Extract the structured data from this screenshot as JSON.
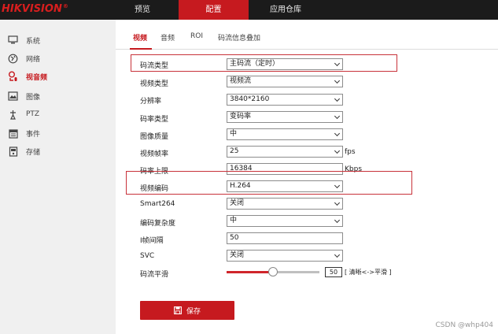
{
  "brand": {
    "logo_text": "HIKVISION",
    "reg_mark": "®"
  },
  "top_nav": [
    "预览",
    "配置",
    "应用仓库"
  ],
  "sidebar": {
    "items": [
      {
        "label": "系统",
        "icon": "monitor-icon"
      },
      {
        "label": "网络",
        "icon": "globe-icon"
      },
      {
        "label": "视音频",
        "icon": "camera-mic-icon",
        "active": true
      },
      {
        "label": "图像",
        "icon": "image-icon"
      },
      {
        "label": "PTZ",
        "icon": "ptz-icon"
      },
      {
        "label": "事件",
        "icon": "calendar-icon"
      },
      {
        "label": "存储",
        "icon": "storage-icon"
      }
    ]
  },
  "subtabs": [
    "视频",
    "音频",
    "ROI",
    "码流信息叠加"
  ],
  "form": {
    "stream_type": {
      "label": "码流类型",
      "value": "主码流（定时）"
    },
    "video_type": {
      "label": "视频类型",
      "value": "视频流"
    },
    "resolution": {
      "label": "分辨率",
      "value": "3840*2160"
    },
    "bitrate_type": {
      "label": "码率类型",
      "value": "变码率"
    },
    "image_quality": {
      "label": "图像质量",
      "value": "中"
    },
    "frame_rate": {
      "label": "视频帧率",
      "value": "25",
      "unit": "fps"
    },
    "bitrate_limit": {
      "label": "码率上限",
      "value": "16384",
      "unit": "Kbps"
    },
    "video_encoding": {
      "label": "视频编码",
      "value": "H.264"
    },
    "smart264": {
      "label": "Smart264",
      "value": "关闭"
    },
    "encoding_complexity": {
      "label": "编码复杂度",
      "value": "中"
    },
    "i_frame_interval": {
      "label": "I帧间隔",
      "value": "50"
    },
    "svc": {
      "label": "SVC",
      "value": "关闭"
    },
    "stream_smoothing": {
      "label": "码流平滑",
      "value": "50",
      "level": 0.5,
      "hint": "[ 清晰<->平滑 ]"
    }
  },
  "save_label": "保存",
  "watermark": "CSDN @whp404",
  "colors": {
    "accent": "#c61a1f",
    "highlight": "#c8323a"
  }
}
